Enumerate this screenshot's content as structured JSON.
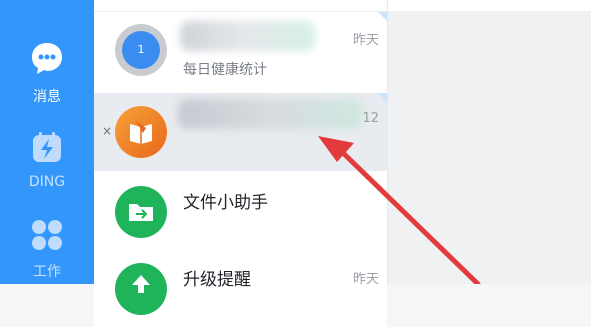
{
  "nav": {
    "items": [
      {
        "label": "消息",
        "icon": "chat-bubble-icon"
      },
      {
        "label": "DING",
        "icon": "ding-lightning-icon"
      },
      {
        "label": "工作",
        "icon": "workbench-grid-icon"
      }
    ]
  },
  "list": {
    "rows": [
      {
        "avatar_text": "1",
        "subtitle": "每日健康统计",
        "time": "昨天"
      },
      {
        "time": "12",
        "close": "×"
      },
      {
        "title": "文件小助手"
      },
      {
        "title": "升级提醒",
        "time": "昨天"
      }
    ]
  },
  "colors": {
    "nav_bg": "#3296fa",
    "active_row": "#e8ebef",
    "arrow": "#e33b3b",
    "file_helper": "#1fb35a",
    "orange": "#f28a1e"
  }
}
